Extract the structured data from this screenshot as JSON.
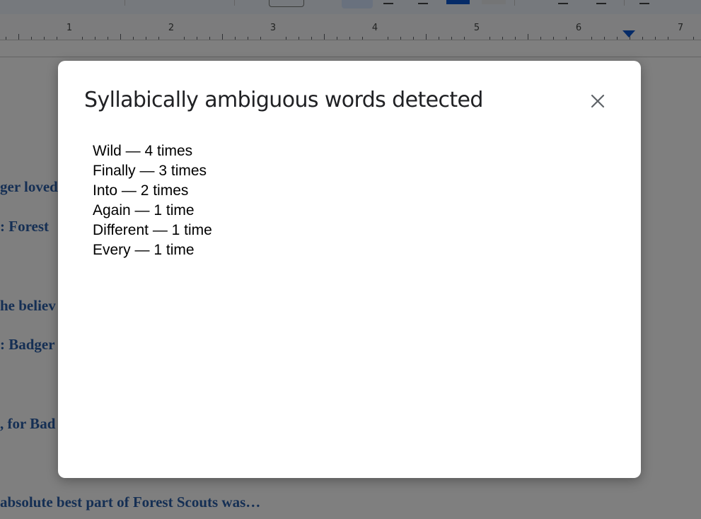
{
  "ruler": {
    "numbers": [
      "1",
      "2",
      "3",
      "4",
      "5",
      "6",
      "7"
    ]
  },
  "document": {
    "lines": [
      "ger loved",
      ": Forest",
      "he believ",
      ": Badger",
      ", for Bad",
      "absolute best part of Forest Scouts was…"
    ]
  },
  "dialog": {
    "title": "Syllabically ambiguous words detected",
    "close_icon": "close-icon",
    "items": [
      "Wild — 4 times",
      "Finally — 3 times",
      "Into — 2 times",
      "Again — 1 time",
      "Different — 1 time",
      "Every — 1 time"
    ]
  },
  "colors": {
    "accent": "#0b57d0",
    "doc_text": "#2a5ea8",
    "scrim": "rgba(0,0,0,0.5)"
  }
}
